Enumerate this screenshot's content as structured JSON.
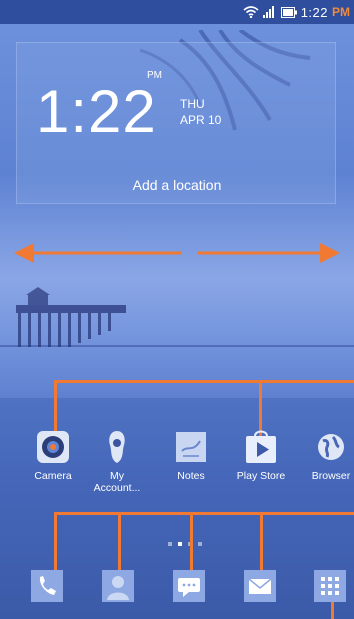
{
  "status_bar": {
    "time": "1:22",
    "ampm": "PM"
  },
  "clock_widget": {
    "time": "1:22",
    "ampm": "PM",
    "day": "THU",
    "date": "APR 10",
    "location_prompt": "Add a location"
  },
  "apps": [
    {
      "label": "Camera",
      "icon": "camera-icon"
    },
    {
      "label": "My Account...",
      "icon": "my-account-icon"
    },
    {
      "label": "Notes",
      "icon": "notes-icon"
    },
    {
      "label": "Play Store",
      "icon": "play-store-icon"
    },
    {
      "label": "Browser",
      "icon": "browser-icon"
    }
  ],
  "dock": [
    {
      "icon": "phone-icon"
    },
    {
      "icon": "contacts-icon"
    },
    {
      "icon": "messaging-icon"
    },
    {
      "icon": "email-icon"
    },
    {
      "icon": "app-drawer-icon"
    }
  ],
  "pager": {
    "count": 4,
    "current": 2
  },
  "colors": {
    "annotation": "#f07a34",
    "status_bar": "#2f4f9e",
    "wallpaper": "#5e82d2"
  }
}
